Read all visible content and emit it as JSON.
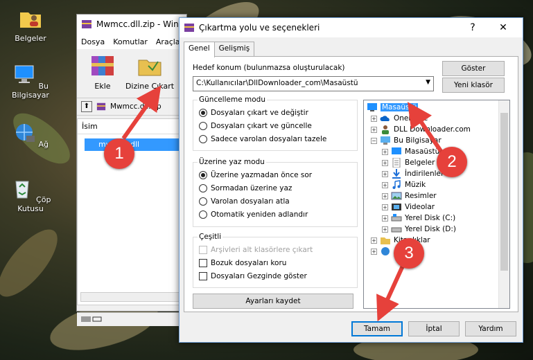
{
  "desktop": {
    "icons": [
      {
        "label": "Belgeler",
        "icon": "folder-user-icon"
      },
      {
        "label": "Bu Bilgisayar",
        "icon": "computer-icon"
      },
      {
        "label": "Ağ",
        "icon": "network-icon"
      },
      {
        "label": "Çöp Kutusu",
        "icon": "recycle-bin-icon"
      }
    ]
  },
  "winrar": {
    "title": "Mwmcc.dll.zip - Win",
    "menu": [
      "Dosya",
      "Komutlar",
      "Araçla"
    ],
    "tools": {
      "add": "Ekle",
      "extract": "Dizine Çıkart"
    },
    "path": "Mwmcc.dll.zip",
    "column_name": "İsim",
    "file": "mwmcc.dll"
  },
  "dialog": {
    "title": "Çıkartma yolu ve seçenekleri",
    "help": "?",
    "close": "✕",
    "tabs": [
      "Genel",
      "Gelişmiş"
    ],
    "dest_label": "Hedef konum (bulunmazsa oluşturulacak)",
    "dest_value": "C:\\Kullanıcılar\\DllDownloader_com\\Masaüstü",
    "show_button": "Göster",
    "new_folder_button": "Yeni klasör",
    "update_mode": {
      "title": "Güncelleme modu",
      "options": [
        "Dosyaları çıkart ve değiştir",
        "Dosyaları çıkart ve güncelle",
        "Sadece varolan dosyaları tazele"
      ],
      "selected": 0
    },
    "overwrite_mode": {
      "title": "Üzerine yaz modu",
      "options": [
        "Üzerine yazmadan önce sor",
        "Sormadan üzerine yaz",
        "Varolan dosyaları atla",
        "Otomatik yeniden adlandır"
      ],
      "selected": 0
    },
    "misc": {
      "title": "Çeşitli",
      "options": [
        "Arşivleri alt klasörlere çıkart",
        "Bozuk dosyaları koru",
        "Dosyaları Gezginde göster"
      ]
    },
    "save_settings": "Ayarları kaydet",
    "tree": [
      {
        "label": "Masaüstü",
        "icon": "desktop-icon",
        "selected": true
      },
      {
        "label": "OneDrive",
        "icon": "onedrive-icon"
      },
      {
        "label": "DLL Downloader.com",
        "icon": "user-icon"
      },
      {
        "label": "Bu Bilgisayar",
        "icon": "computer-icon"
      },
      {
        "label": "Masaüstü",
        "icon": "desktop-icon"
      },
      {
        "label": "Belgeler",
        "icon": "document-icon"
      },
      {
        "label": "İndirilenler",
        "icon": "download-icon"
      },
      {
        "label": "Müzik",
        "icon": "music-icon"
      },
      {
        "label": "Resimler",
        "icon": "pictures-icon"
      },
      {
        "label": "Videolar",
        "icon": "video-icon"
      },
      {
        "label": "Yerel Disk (C:)",
        "icon": "drive-icon"
      },
      {
        "label": "Yerel Disk (D:)",
        "icon": "drive-icon"
      },
      {
        "label": "Kitaplıklar",
        "icon": "library-icon"
      },
      {
        "label": "Ağ",
        "icon": "network-icon"
      }
    ],
    "buttons": {
      "ok": "Tamam",
      "cancel": "İptal",
      "help": "Yardım"
    }
  },
  "annotations": {
    "badges": [
      "1",
      "2",
      "3"
    ],
    "color": "#e6413b"
  }
}
